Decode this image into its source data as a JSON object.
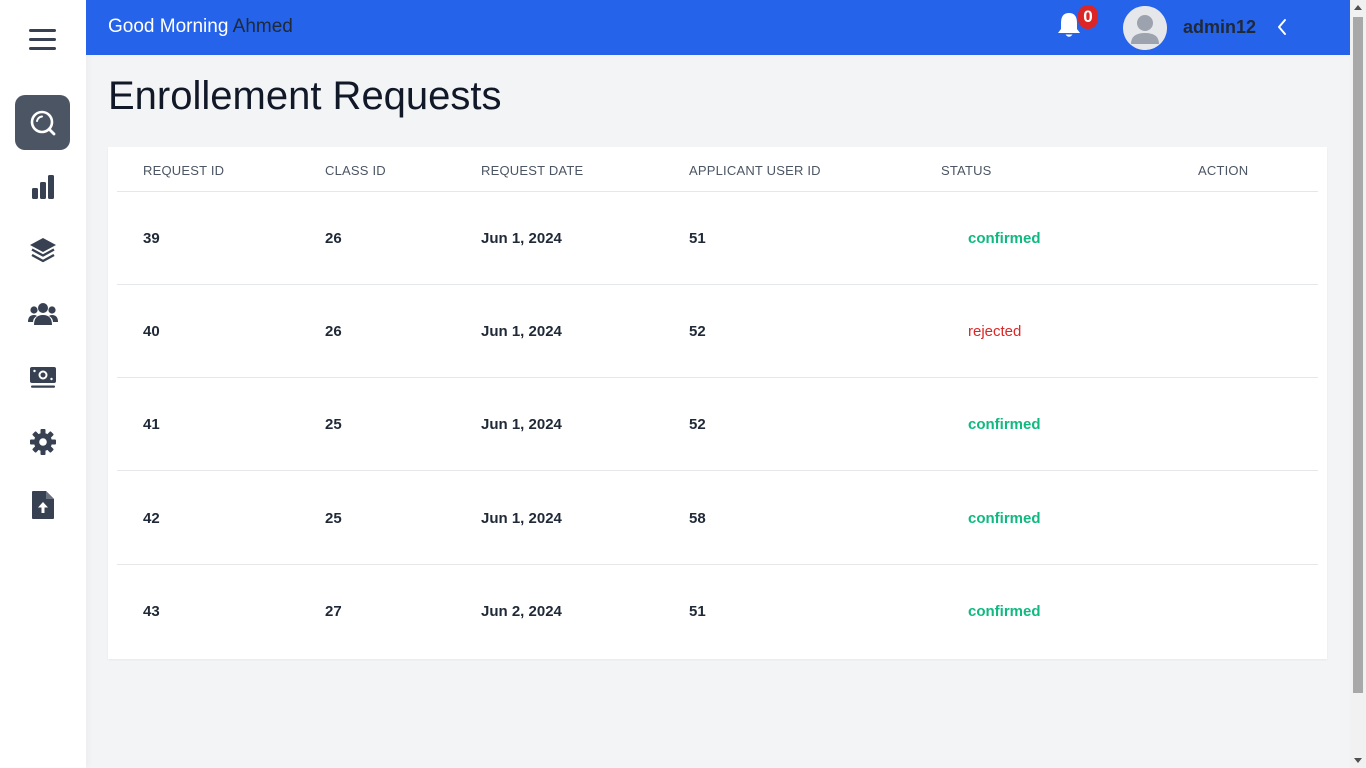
{
  "header": {
    "greeting": "Good Morning",
    "user_name": "Ahmed",
    "notification_count": "0",
    "username": "admin12"
  },
  "sidebar": {
    "items": [
      {
        "icon": "search-icon",
        "active": true
      },
      {
        "icon": "bar-chart-icon",
        "active": false
      },
      {
        "icon": "layers-icon",
        "active": false
      },
      {
        "icon": "users-icon",
        "active": false
      },
      {
        "icon": "money-icon",
        "active": false
      },
      {
        "icon": "gear-icon",
        "active": false
      },
      {
        "icon": "file-upload-icon",
        "active": false
      }
    ]
  },
  "page": {
    "title": "Enrollement Requests"
  },
  "table": {
    "columns": [
      "REQUEST ID",
      "CLASS ID",
      "REQUEST DATE",
      "APPLICANT USER ID",
      "STATUS",
      "ACTION"
    ],
    "rows": [
      {
        "request_id": "39",
        "class_id": "26",
        "request_date": "Jun 1, 2024",
        "applicant_user_id": "51",
        "status": "confirmed"
      },
      {
        "request_id": "40",
        "class_id": "26",
        "request_date": "Jun 1, 2024",
        "applicant_user_id": "52",
        "status": "rejected"
      },
      {
        "request_id": "41",
        "class_id": "25",
        "request_date": "Jun 1, 2024",
        "applicant_user_id": "52",
        "status": "confirmed"
      },
      {
        "request_id": "42",
        "class_id": "25",
        "request_date": "Jun 1, 2024",
        "applicant_user_id": "58",
        "status": "confirmed"
      },
      {
        "request_id": "43",
        "class_id": "27",
        "request_date": "Jun 2, 2024",
        "applicant_user_id": "51",
        "status": "confirmed"
      }
    ]
  },
  "colors": {
    "header": "#2563eb",
    "confirmed": "#10b981",
    "rejected": "#dc2626",
    "badge": "#dc2626",
    "sidebar_active": "#4b5563"
  }
}
